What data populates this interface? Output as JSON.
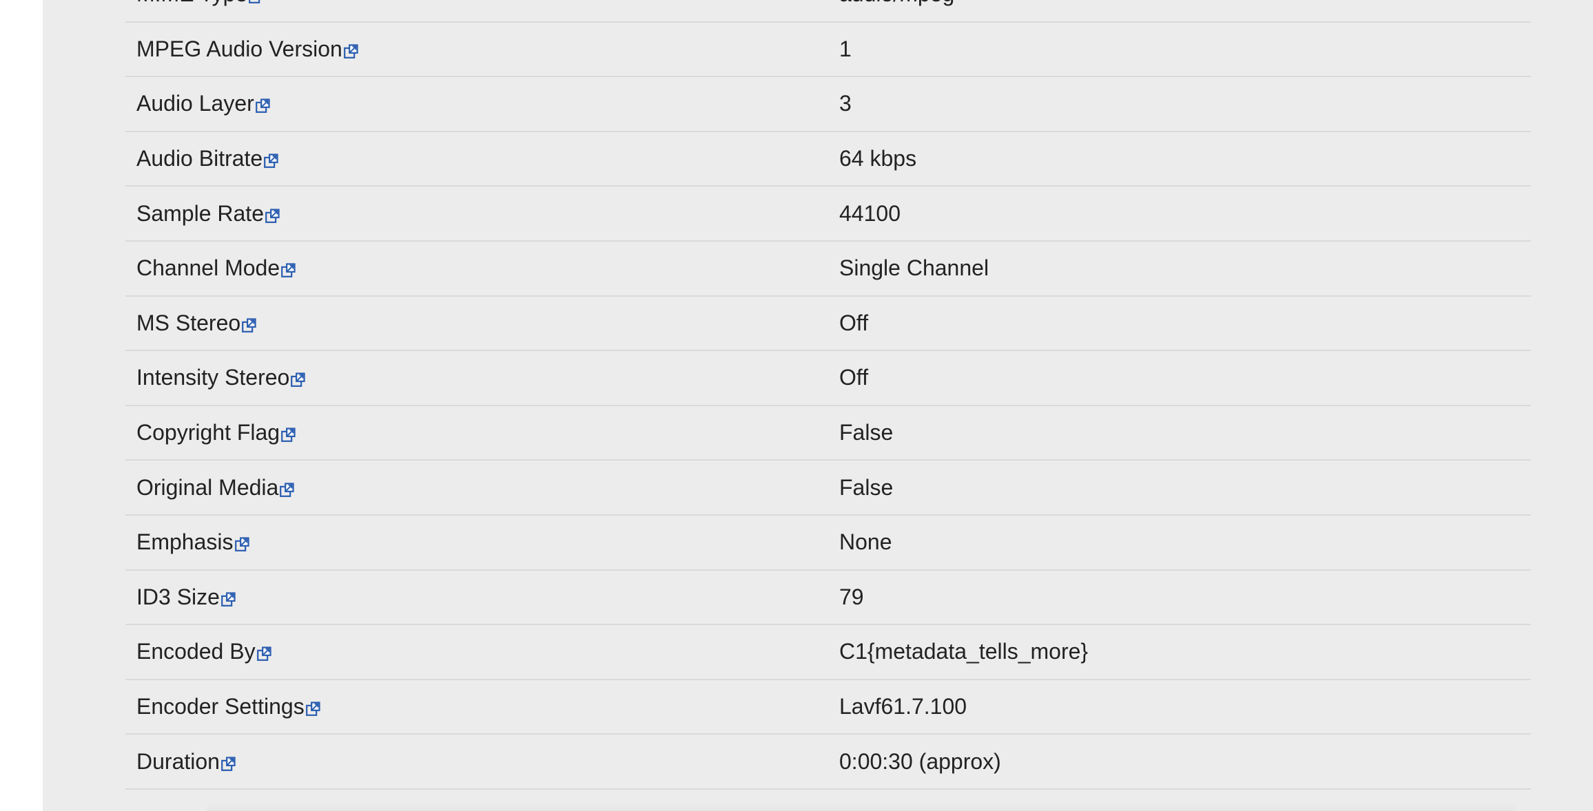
{
  "metadata": {
    "rows": [
      {
        "key": "MIME Type",
        "value": "audio/mpeg"
      },
      {
        "key": "MPEG Audio Version",
        "value": "1"
      },
      {
        "key": "Audio Layer",
        "value": "3"
      },
      {
        "key": "Audio Bitrate",
        "value": "64 kbps"
      },
      {
        "key": "Sample Rate",
        "value": "44100"
      },
      {
        "key": "Channel Mode",
        "value": "Single Channel"
      },
      {
        "key": "MS Stereo",
        "value": "Off"
      },
      {
        "key": "Intensity Stereo",
        "value": "Off"
      },
      {
        "key": "Copyright Flag",
        "value": "False"
      },
      {
        "key": "Original Media",
        "value": "False"
      },
      {
        "key": "Emphasis",
        "value": "None"
      },
      {
        "key": "ID3 Size",
        "value": "79"
      },
      {
        "key": "Encoded By",
        "value": "C1{metadata_tells_more}"
      },
      {
        "key": "Encoder Settings",
        "value": "Lavf61.7.100"
      },
      {
        "key": "Duration",
        "value": "0:00:30 (approx)"
      }
    ]
  },
  "icons": {
    "row_link_icon": "external-link-icon"
  },
  "colors": {
    "panel_bg": "#ececec",
    "row_border": "#dadada",
    "text": "#222222",
    "link_icon": "#2a5db0"
  }
}
